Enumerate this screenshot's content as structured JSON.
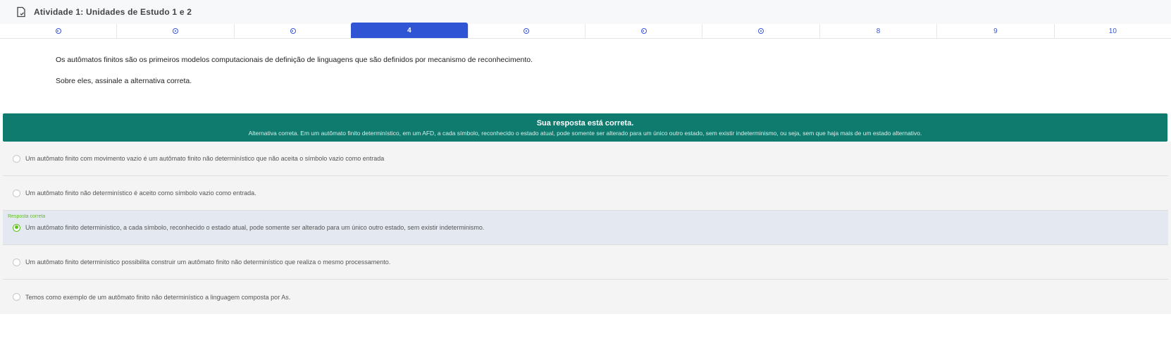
{
  "header": {
    "title": "Atividade 1: Unidades de Estudo 1 e 2",
    "icon": "document-check-icon"
  },
  "nav": {
    "items": [
      {
        "label": "",
        "state": "answered"
      },
      {
        "label": "",
        "state": "answered"
      },
      {
        "label": "",
        "state": "answered"
      },
      {
        "label": "4",
        "state": "current"
      },
      {
        "label": "",
        "state": "answered"
      },
      {
        "label": "",
        "state": "answered"
      },
      {
        "label": "",
        "state": "answered"
      },
      {
        "label": "8",
        "state": "unanswered"
      },
      {
        "label": "9",
        "state": "unanswered"
      },
      {
        "label": "10",
        "state": "unanswered"
      }
    ],
    "accent": "#2f54d4"
  },
  "question": {
    "statement": "Os autômatos finitos são os primeiros modelos computacionais de definição de linguagens que são definidos por mecanismo de reconhecimento.",
    "prompt": "Sobre eles, assinale a alternativa correta."
  },
  "feedback": {
    "title": "Sua resposta está correta.",
    "text": "Alternativa correta. Em um autômato finito determinístico, em um AFD, a cada símbolo, reconhecido o estado atual, pode somente ser alterado para um único outro estado, sem existir indeterminismo, ou seja, sem que haja mais de um estado alternativo.",
    "color": "#0e7b6e"
  },
  "options": [
    {
      "text": "Um autômato finito com movimento vazio é um autômato finito não determinístico que não aceita o símbolo vazio como entrada",
      "selected": false,
      "tag": ""
    },
    {
      "text": "Um autômato finito não determinístico é aceito como símbolo vazio como entrada.",
      "selected": false,
      "tag": ""
    },
    {
      "text": "Um autômato finito determinístico, a cada símbolo, reconhecido o estado atual, pode somente ser alterado para um único outro estado, sem existir indeterminismo.",
      "selected": true,
      "tag": "Resposta correta"
    },
    {
      "text": "Um autômato finito determinístico possibilita construir um autômato finito não determinístico que realiza o mesmo processamento.",
      "selected": false,
      "tag": ""
    },
    {
      "text": "Temos como exemplo de um autômato finito não determinístico a linguagem composta por As.",
      "selected": false,
      "tag": ""
    }
  ]
}
